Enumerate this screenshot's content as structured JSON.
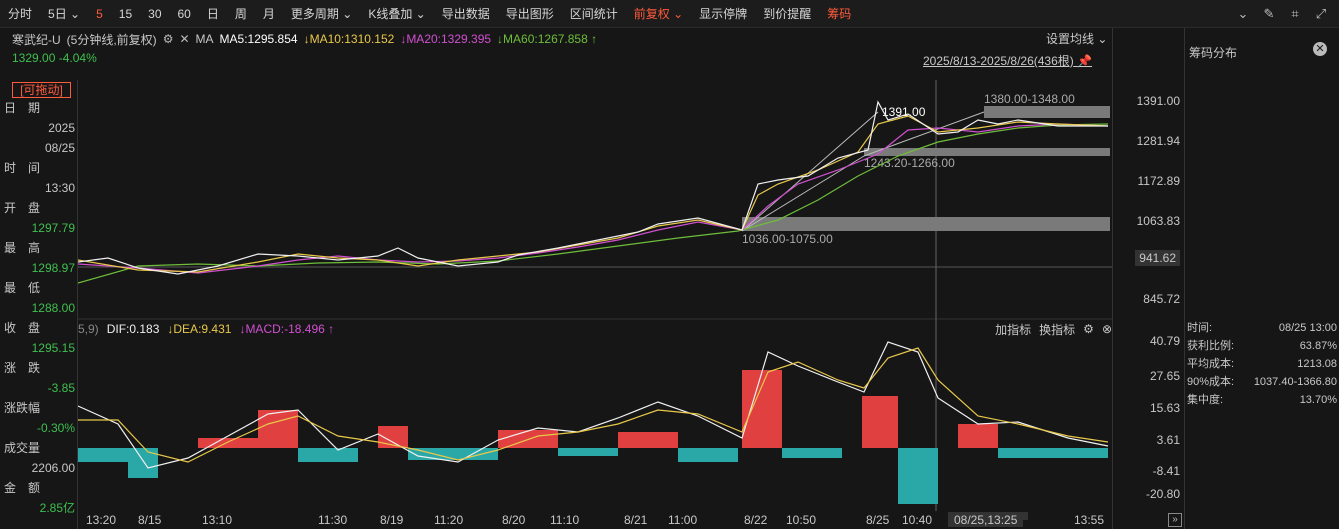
{
  "toolbar": {
    "items": [
      "分时",
      "5日",
      "5",
      "15",
      "30",
      "60",
      "日",
      "周",
      "月",
      "更多周期",
      "K线叠加",
      "导出数据",
      "导出图形",
      "区间统计",
      "前复权",
      "显示停牌",
      "到价提醒",
      "筹码"
    ],
    "active": "5"
  },
  "header": {
    "stock": "寒武纪-U",
    "mode": "(5分钟线,前复权)",
    "ma_label": "MA",
    "ma5": "MA5:1295.854",
    "ma10": "MA10:1310.152",
    "ma20": "MA20:1329.395",
    "ma60": "MA60:1267.858",
    "price_line": "1329.00 -4.04%",
    "settings": "设置均线",
    "range": "2025/8/13-2025/8/26(436根)"
  },
  "side": {
    "drag": "[可拖动]",
    "date_label": "日　期",
    "year": "2025",
    "date": "08/25",
    "time_label": "时　间",
    "time": "13:30",
    "open_label": "开　盘",
    "open": "1297.79",
    "high_label": "最　高",
    "high": "1298.97",
    "low_label": "最　低",
    "low": "1288.00",
    "close_label": "收　盘",
    "close": "1295.15",
    "change_label": "涨　跌",
    "change": "-3.85",
    "pct_label": "涨跌幅",
    "pct": "-0.30%",
    "vol_label": "成交量",
    "vol": "2206.00",
    "amt_label": "金　额",
    "amt": "2.85亿"
  },
  "price_axis": [
    "1391.00",
    "1281.94",
    "1172.89",
    "1063.83",
    "941.62",
    "845.72"
  ],
  "macd_axis": [
    "40.79",
    "27.65",
    "15.63",
    "3.61",
    "-8.41",
    "-20.80"
  ],
  "annotations": {
    "zone_top": "1380.00-1348.00",
    "zone_mid": "1243.20-1266.00",
    "zone_low": "1036.00-1075.00",
    "peak": "1391.00"
  },
  "macd": {
    "dif": "DIF:0.183",
    "dea": "DEA:9.431",
    "macd": "MACD:-18.496",
    "add": "加指标",
    "swap": "换指标"
  },
  "xaxis": [
    "13:20",
    "8/15",
    "13:10",
    "11:30",
    "8/19",
    "11:20",
    "8/20",
    "11:10",
    "8/21",
    "11:00",
    "8/22",
    "10:50",
    "8/25",
    "10:40",
    "08/25,13:25",
    "13:55"
  ],
  "chips": {
    "title": "筹码分布",
    "time_label": "时间:",
    "time": "08/25 13:00",
    "profit_label": "获利比例:",
    "profit": "63.87%",
    "avg_label": "平均成本:",
    "avg": "1213.08",
    "c90_label": "90%成本:",
    "c90": "1037.40-1366.80",
    "conc_label": "集中度:",
    "conc": "13.70%"
  },
  "chart_data": {
    "type": "line",
    "title": "",
    "series": [
      {
        "name": "MA60",
        "values": [
          905,
          910,
          915,
          920,
          925,
          930,
          935,
          945,
          955,
          970,
          990,
          1020,
          1050,
          1080,
          1110,
          1140,
          1180,
          1210,
          1240,
          1260,
          1268
        ]
      }
    ]
  }
}
